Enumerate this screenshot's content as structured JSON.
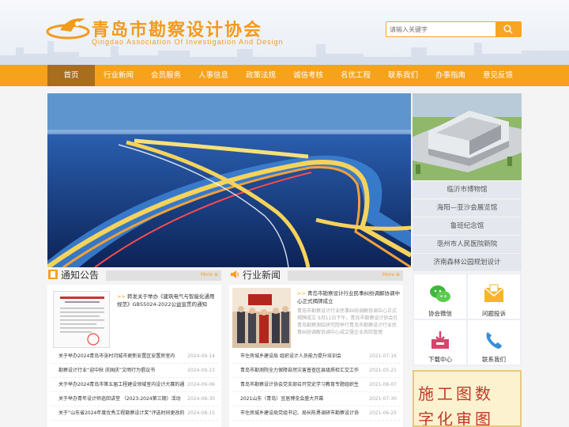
{
  "header": {
    "title": "青岛市勘察设计协会",
    "subtitle": "Qingdao Association Of Investigation And Design",
    "search_placeholder": "请输入关键字"
  },
  "nav": [
    "首页",
    "行业新闻",
    "会员服务",
    "人事信息",
    "政策法规",
    "诚信考核",
    "名优工程",
    "联系我们",
    "办事指南",
    "意见反馈"
  ],
  "projects": [
    "临沂市博物馆",
    "海阳—亚沙会展览馆",
    "鲁班纪念馆",
    "亳州市人民医院新院",
    "济南森林公园规划设计"
  ],
  "notice": {
    "title": "通知公告",
    "more": "More",
    "feature_title": "转发关于举办《建筑电气与智能化通用规范》GB55024-2022公益宣贯的通知",
    "items": [
      {
        "text": "关于举办2024青岛市张村河城市更新安置区安置房室内",
        "date": "2024-09-14"
      },
      {
        "text": "勘察设计行业“迎中秋 庆国庆”文明行为倡议书",
        "date": "2024-09-13"
      },
      {
        "text": "关于举办2024青岛市第五届工程建设领域室内设计大赛的通",
        "date": "2024-09-06"
      },
      {
        "text": "关于举办青年设计师巡回讲堂 （2023-2024第三期）活动",
        "date": "2024-08-30"
      },
      {
        "text": "关于“山东省2024年度优秀工程勘察设计奖”评选时间更改的",
        "date": "2024-08-15"
      }
    ]
  },
  "news": {
    "title": "行业新闻",
    "more": "More",
    "feature_title": "青岛市勘察设计行业民事纠纷调解协调中心正式揭牌成立",
    "feature_desc": "青岛市勘察设计行业民事纠纷调解协调中心正式揭牌成立 9月11日下午，青岛市勘察设计协会在青岛勘察测绘研究院举行青岛市勘察设计行业民事纠纷调解协调中心成立暨企业风险管理",
    "items": [
      {
        "text": "市住房城乡建设局 组织设计人员能力提升培训会",
        "date": "2021-07-16"
      },
      {
        "text": "青岛市勘测院全力保障自然灾害普查区县级质检汇交工作",
        "date": "2021-05-21"
      },
      {
        "text": "青岛市勘察设计协会党支部召开党史学习教育专题组织生",
        "date": "2021-08-07"
      },
      {
        "text": "2021山东（青岛）宜居博览会盛大开幕",
        "date": "2021-07-30"
      },
      {
        "text": "市住房城乡建设局党组书记、局长陈勇调研市勘察设计协",
        "date": "2021-06-25"
      }
    ]
  },
  "quick": [
    "协会微信",
    "问题投诉",
    "下载中心",
    "联系我们"
  ],
  "ad": {
    "line1": "施工图数",
    "line2": "字化审图"
  }
}
